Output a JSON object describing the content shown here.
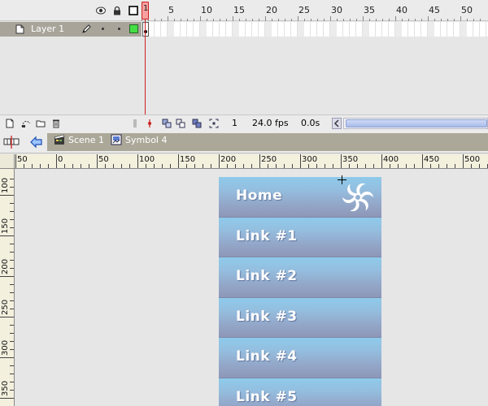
{
  "timeline": {
    "frame_numbers": [
      "1",
      "5",
      "10",
      "15",
      "20",
      "25",
      "30",
      "35",
      "40",
      "45",
      "50"
    ],
    "current_frame_marker": "1",
    "layer": {
      "name": "Layer 1",
      "color": "#44dd44"
    },
    "footer": {
      "frame": "1",
      "fps": "24.0 fps",
      "time": "0.0s"
    },
    "icons": {
      "eye": "eye-icon",
      "lock": "lock-icon",
      "outline": "outline-icon",
      "insert_layer": "insert-layer-icon",
      "motion_guide": "motion-guide-icon",
      "folder": "folder-icon",
      "trash": "trash-icon",
      "center_frame": "center-frame-icon",
      "onion_skin": "onion-skin-icon",
      "onion_outlines": "onion-outlines-icon",
      "edit_multiple": "edit-multiple-frames-icon",
      "modify_markers": "modify-markers-icon"
    }
  },
  "edit_bar": {
    "breadcrumbs": [
      {
        "label": "Scene 1",
        "icon": "scene-icon"
      },
      {
        "label": "Symbol 4",
        "icon": "symbol-icon"
      }
    ]
  },
  "rulers": {
    "horizontal_labels": [
      "50",
      "0",
      "50",
      "100",
      "150",
      "200",
      "250",
      "300",
      "350",
      "400",
      "450",
      "500"
    ],
    "vertical_labels": [
      "100",
      "150",
      "200",
      "250",
      "300",
      "350"
    ]
  },
  "stage": {
    "menu_items": [
      "Home",
      "Link #1",
      "Link #2",
      "Link #3",
      "Link #4",
      "Link #5"
    ],
    "button_color_top": "#8ecaea",
    "button_color_bottom": "#8e97b7"
  }
}
